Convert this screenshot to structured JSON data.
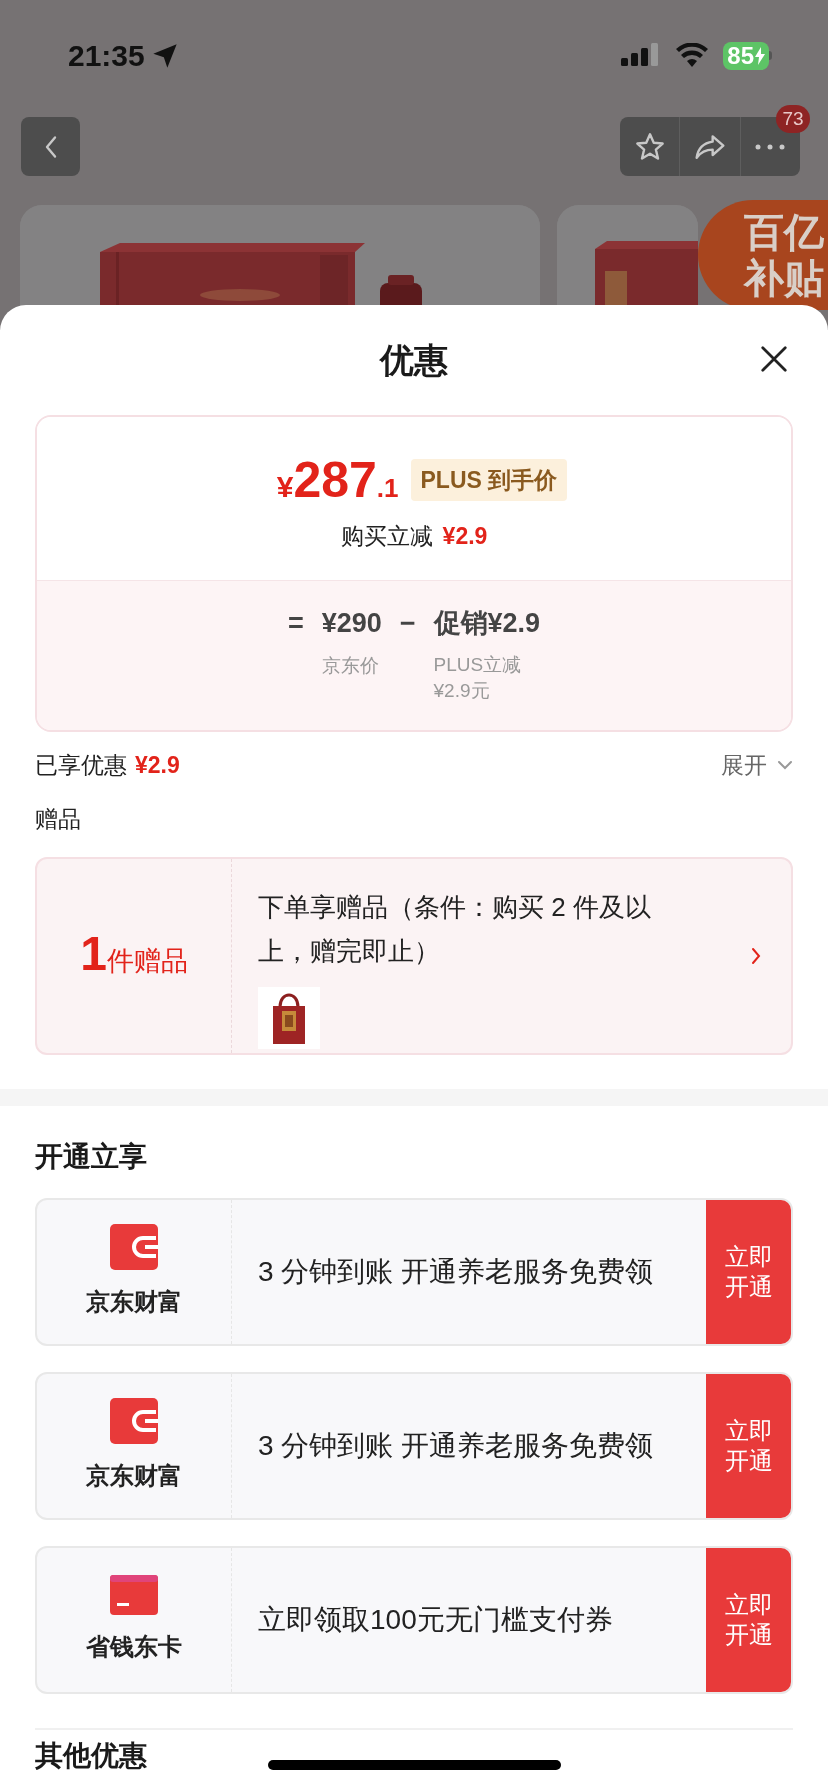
{
  "status_bar": {
    "time": "21:35",
    "battery": "85"
  },
  "nav": {
    "badge": "73"
  },
  "promo_badge": {
    "lines": [
      "百亿",
      "补贴"
    ]
  },
  "sheet": {
    "title": "优惠"
  },
  "price_card": {
    "currency": "¥",
    "price_int": "287",
    "price_dec": ".1",
    "tag": "PLUS 到手价",
    "reduce_label": "购买立减",
    "reduce_amount": "¥2.9",
    "formula": {
      "equals": "=",
      "base": "¥290",
      "base_label": "京东价",
      "minus": "−",
      "promo": "促销¥2.9",
      "promo_label": [
        "PLUS立减",
        "¥2.9元"
      ]
    }
  },
  "enjoyed": {
    "label": "已享优惠",
    "amount": "¥2.9",
    "toggle": "展开"
  },
  "gifts": {
    "title": "赠品",
    "count": "1",
    "count_label": "件赠品",
    "desc": "下单享赠品（条件：购买 2 件及以上，赠完即止）"
  },
  "open_section": {
    "title": "开通立享",
    "offers": [
      {
        "kind": "wallet",
        "brand": "京东财富",
        "text": "3 分钟到账 开通养老服务免费领",
        "button": "立即开通"
      },
      {
        "kind": "wallet",
        "brand": "京东财富",
        "text": "3 分钟到账 开通养老服务免费领",
        "button": "立即开通"
      },
      {
        "kind": "card",
        "brand": "省钱东卡",
        "text": "立即领取100元无门槛支付券",
        "button": "立即开通"
      }
    ]
  },
  "other_section": {
    "title": "其他优惠"
  }
}
